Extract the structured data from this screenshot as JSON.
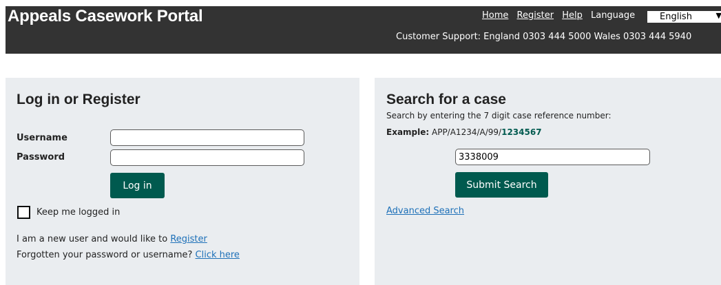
{
  "header": {
    "brand": "Appeals Casework Portal",
    "nav": {
      "home": "Home",
      "register": "Register",
      "help": "Help",
      "language_label": "Language"
    },
    "language_selected": "English",
    "support": "Customer Support: England 0303 444 5000    Wales  0303 444 5940"
  },
  "login": {
    "title": "Log in or Register",
    "username_label": "Username",
    "password_label": "Password",
    "username_value": "",
    "password_value": "",
    "login_button": "Log in",
    "keep_logged_in": "Keep me logged in",
    "new_user_text": "I am a new user and would like to ",
    "register_link": "Register",
    "forgot_text": "Forgotten your password or username? ",
    "click_here_link": "Click here"
  },
  "search": {
    "title": "Search for a case",
    "instructions": "Search by entering the 7 digit case reference number:",
    "example_label": "Example:",
    "example_prefix": " APP/A1234/A/99/",
    "example_number": "1234567",
    "case_value": "3338009",
    "submit_button": "Submit Search",
    "advanced_link": "Advanced Search"
  },
  "colors": {
    "header_bg": "#333333",
    "panel_bg": "#eaedf0",
    "button_bg": "#005a4f",
    "link": "#1d70b8"
  }
}
